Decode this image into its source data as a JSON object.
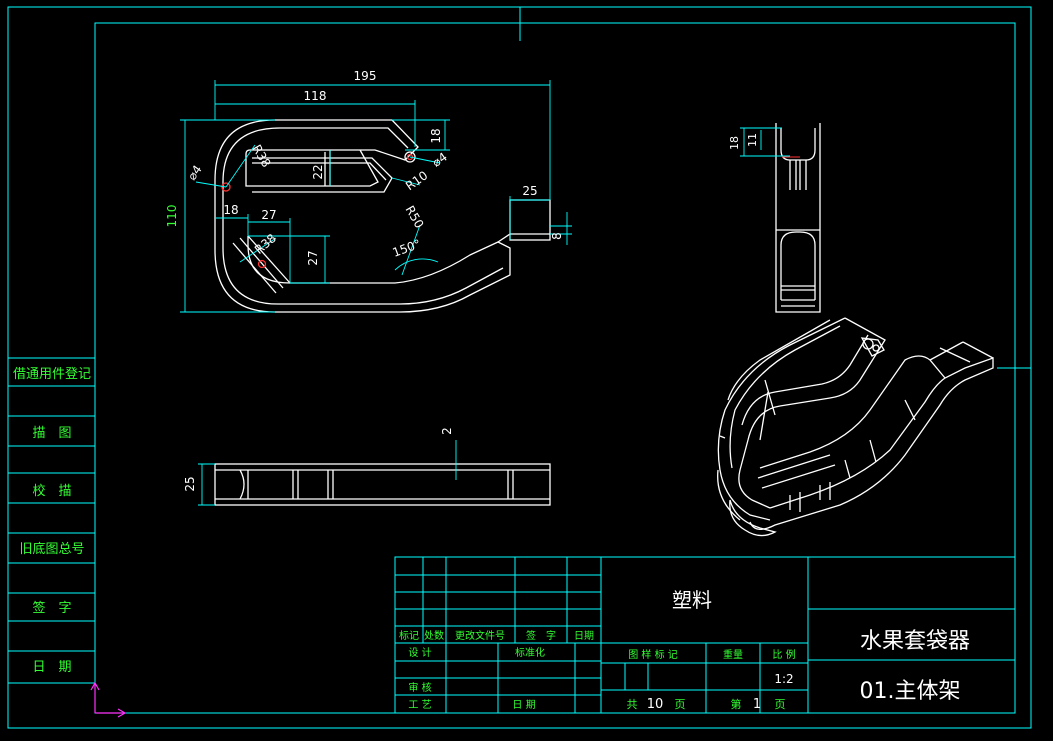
{
  "colors": {
    "background": "#000000",
    "frame": "#00ffff",
    "geometry": "#ffffff",
    "dimension": "#00ffff",
    "dim_text": "#ffffff",
    "rotated_dim_text": "#33ff33",
    "table_text": "#33ff33",
    "ucs": "#ff33ff"
  },
  "side_panel": {
    "labels": [
      "借通用件登记",
      "描　图",
      "校　描",
      "旧底图总号",
      "签　字",
      "日　期"
    ]
  },
  "front_view": {
    "dims": {
      "overall_width": "195",
      "inner_width": "118",
      "height": "110",
      "top_slot": "18",
      "hole_left": "⌀4",
      "hole_right": "⌀4",
      "radius_outer": "R38",
      "radius_inner": "R10",
      "radius_bend": "R50",
      "slot_height": "22",
      "tail_length": "25",
      "tail_height": "8",
      "left_offset": "18",
      "corner_width": "27",
      "corner_height": "27",
      "corner_radius": "R38",
      "angle": "150°"
    }
  },
  "bottom_view": {
    "dims": {
      "width": "25",
      "thickness": "2"
    }
  },
  "side_view": {
    "dims": {
      "outer": "18",
      "inner": "11"
    }
  },
  "title_block": {
    "material": "塑料",
    "product_name": "水果套袋器",
    "part_name": "01.主体架",
    "scale": "1:2",
    "total_sheets": "10",
    "sheet_no": "1",
    "headers": {
      "mark": "标记",
      "count": "处数",
      "change_doc": "更改文件号",
      "signature": "签　字",
      "date": "日期",
      "design": "设 计",
      "standardize": "标准化",
      "stage_mark": "图 样 标 记",
      "weight": "重量",
      "scale": "比 例",
      "review": "审 核",
      "process": "工 艺",
      "date2": "日 期",
      "total": "共",
      "sheet_prefix": "第",
      "page": "页"
    }
  }
}
